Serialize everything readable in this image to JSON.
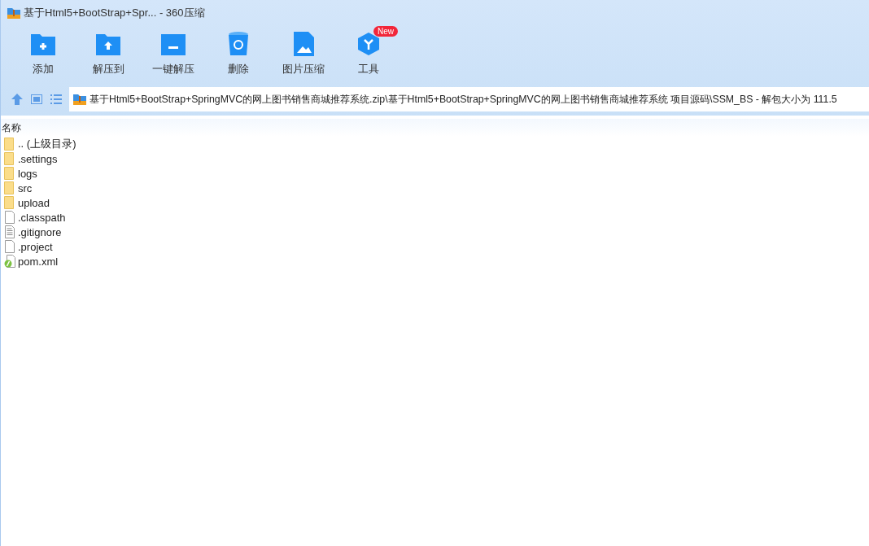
{
  "window": {
    "title": "基于Html5+BootStrap+Spr... - 360压缩"
  },
  "toolbar": [
    {
      "kind": "add",
      "label": "添加"
    },
    {
      "kind": "extract-to",
      "label": "解压到"
    },
    {
      "kind": "extract",
      "label": "一键解压"
    },
    {
      "kind": "delete",
      "label": "删除"
    },
    {
      "kind": "image",
      "label": "图片压缩"
    },
    {
      "kind": "tools",
      "label": "工具",
      "badge": "New"
    }
  ],
  "address": {
    "value": "基于Html5+BootStrap+SpringMVC的网上图书销售商城推荐系统.zip\\基于Html5+BootStrap+SpringMVC的网上图书销售商城推荐系统 项目源码\\SSM_BS - 解包大小为 111.5"
  },
  "table": {
    "columns": [
      "名称"
    ],
    "rows": [
      {
        "kind": "folder",
        "name": ".. (上级目录)"
      },
      {
        "kind": "folder",
        "name": ".settings"
      },
      {
        "kind": "folder",
        "name": "logs"
      },
      {
        "kind": "folder",
        "name": "src"
      },
      {
        "kind": "folder",
        "name": "upload"
      },
      {
        "kind": "file",
        "name": ".classpath"
      },
      {
        "kind": "text",
        "name": ".gitignore"
      },
      {
        "kind": "file",
        "name": ".project"
      },
      {
        "kind": "xml",
        "name": "pom.xml"
      }
    ]
  }
}
